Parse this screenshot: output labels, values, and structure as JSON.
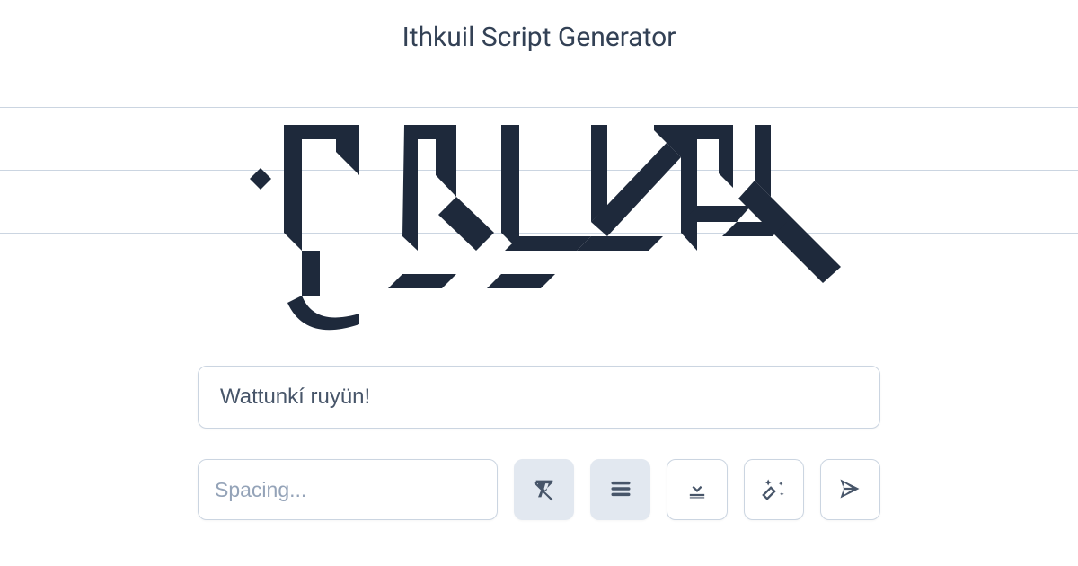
{
  "header": {
    "title": "Ithkuil Script Generator"
  },
  "input": {
    "value": "Wattunkí ruyün!",
    "placeholder": ""
  },
  "spacing": {
    "value": "",
    "placeholder": "Spacing..."
  },
  "icons": {
    "remove_text": "remove-format-icon",
    "lines": "lines-icon",
    "download": "download-icon",
    "magic": "magic-wand-icon",
    "send": "send-icon"
  },
  "colors": {
    "glyph": "#1e293b",
    "guide": "#cbd5e1",
    "text": "#475569",
    "muted": "#94a3b8",
    "filled_bg": "#e2e8f0"
  }
}
